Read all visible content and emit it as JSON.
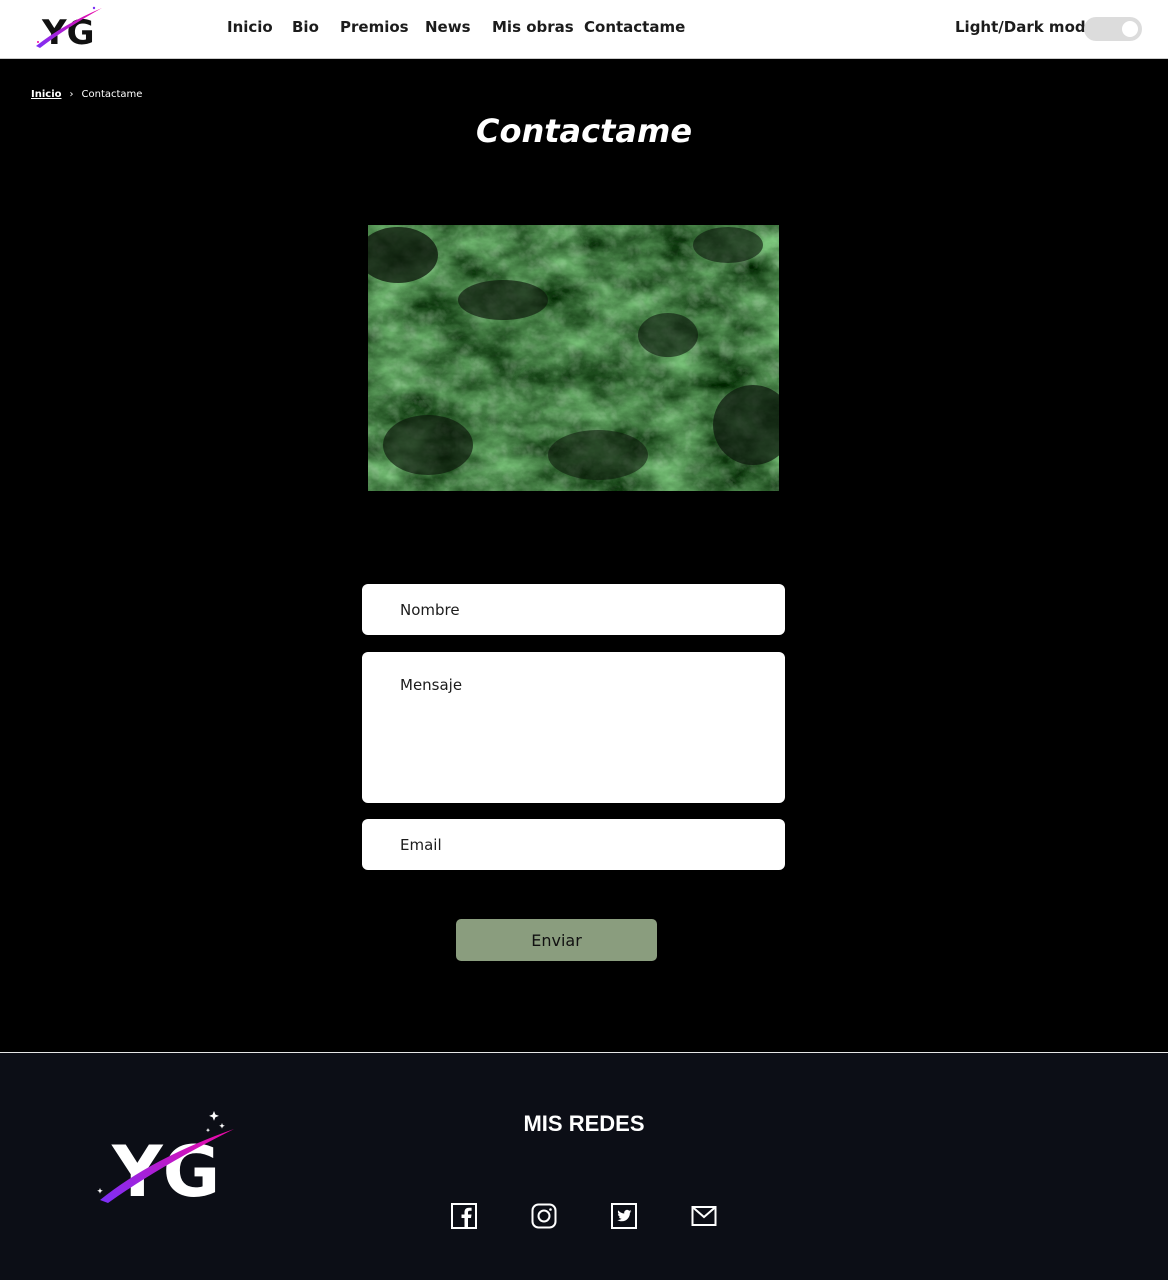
{
  "header": {
    "logo_text": "YG",
    "nav": [
      "Inicio",
      "Bio",
      "Premios",
      "News",
      "Mis obras",
      "Contactame"
    ],
    "mode_label": "Light/Dark mode"
  },
  "breadcrumb": {
    "home": "Inicio",
    "separator": "›",
    "current": "Contactame"
  },
  "page_title": "Contactame",
  "form": {
    "nombre_placeholder": "Nombre",
    "mensaje_placeholder": "Mensaje",
    "email_placeholder": "Email",
    "submit_label": "Enviar"
  },
  "footer": {
    "logo_text": "YG",
    "title": "MIS REDES",
    "social": [
      "facebook-icon",
      "instagram-icon",
      "twitter-icon",
      "mail-icon"
    ]
  },
  "colors": {
    "background": "#000000",
    "footer_background": "#0c0e16",
    "button": "#8a9d7e",
    "logo_gradient_start": "#7b2ff7",
    "logo_gradient_end": "#f107a3"
  }
}
